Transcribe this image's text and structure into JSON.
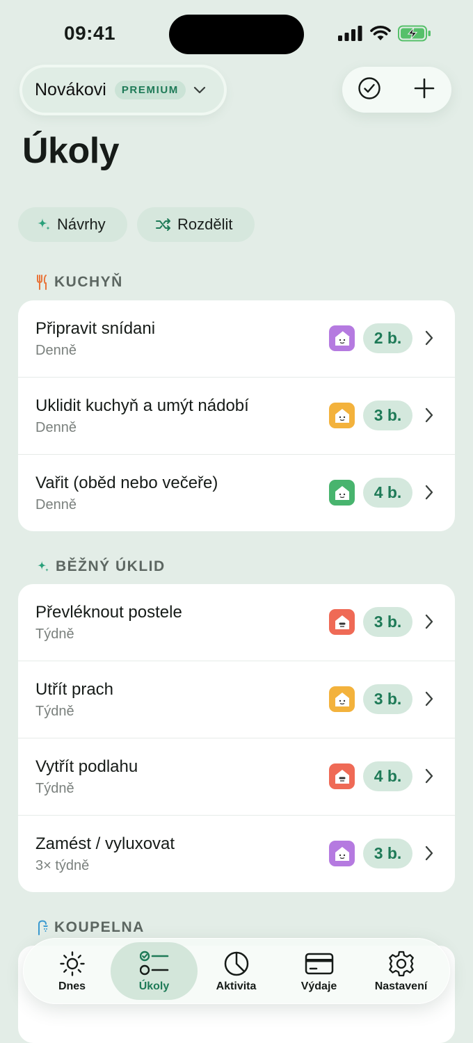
{
  "status_bar": {
    "time": "09:41"
  },
  "header": {
    "household_name": "Novákovi",
    "premium_label": "PREMIUM",
    "title": "Úkoly"
  },
  "chips": {
    "suggest": "Návrhy",
    "split": "Rozdělit"
  },
  "colors": {
    "accent": "#1e7a57",
    "background": "#e3ede7",
    "avatar_purple": "#b57ae0",
    "avatar_orange": "#f3b23c",
    "avatar_green": "#48b46e",
    "avatar_red": "#ef6a56"
  },
  "sections": [
    {
      "title": "KUCHYŇ",
      "icon": "fork-knife-icon",
      "tasks": [
        {
          "title": "Připravit snídani",
          "frequency": "Denně",
          "points": "2 b.",
          "avatar": "purple"
        },
        {
          "title": "Uklidit kuchyň a umýt nádobí",
          "frequency": "Denně",
          "points": "3 b.",
          "avatar": "orange"
        },
        {
          "title": "Vařit (oběd nebo večeře)",
          "frequency": "Denně",
          "points": "4 b.",
          "avatar": "green"
        }
      ]
    },
    {
      "title": "BĚŽNÝ ÚKLID",
      "icon": "sparkle-icon",
      "tasks": [
        {
          "title": "Převléknout postele",
          "frequency": "Týdně",
          "points": "3 b.",
          "avatar": "red"
        },
        {
          "title": "Utřít prach",
          "frequency": "Týdně",
          "points": "3 b.",
          "avatar": "orange"
        },
        {
          "title": "Vytřít podlahu",
          "frequency": "Týdně",
          "points": "4 b.",
          "avatar": "red"
        },
        {
          "title": "Zamést / vyluxovat",
          "frequency": "3× týdně",
          "points": "3 b.",
          "avatar": "purple"
        }
      ]
    },
    {
      "title": "KOUPELNA",
      "icon": "shower-icon",
      "tasks": []
    }
  ],
  "tabs": [
    {
      "label": "Dnes",
      "icon": "sun-icon"
    },
    {
      "label": "Úkoly",
      "icon": "checklist-icon",
      "active": true
    },
    {
      "label": "Aktivita",
      "icon": "pie-chart-icon"
    },
    {
      "label": "Výdaje",
      "icon": "card-icon"
    },
    {
      "label": "Nastavení",
      "icon": "gear-icon"
    }
  ]
}
